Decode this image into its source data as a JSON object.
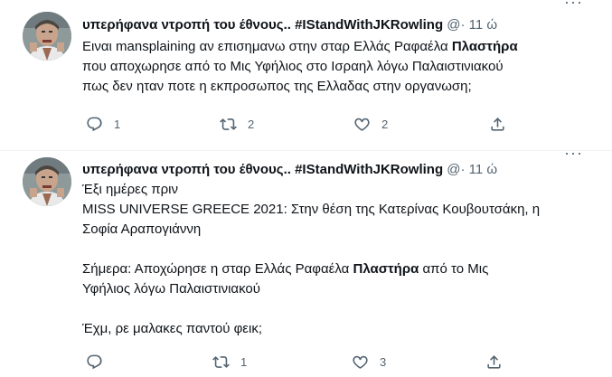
{
  "tweets": [
    {
      "name": "υπερήφανα ντροπή του έθνους.. #IStandWithJKRowling",
      "handle_time": "@· 11 ώ",
      "more": "···",
      "body": [
        {
          "text": "Ειναι mansplaining αν επισημανω στην σταρ Ελλάς Ραφαέλα "
        },
        {
          "text": "Πλαστήρα",
          "bold": true
        },
        {
          "text": "\nπου αποχωρησε από το Μις Υφήλιος στο Ισραηλ λόγω Παλαιστινιακού\nπως δεν ηταν ποτε η εκπροσωπος της Ελλαδας στην οργανωση;"
        }
      ],
      "actions": {
        "reply": "1",
        "retweet": "2",
        "like": "2"
      }
    },
    {
      "name": "υπερήφανα ντροπή του έθνους.. #IStandWithJKRowling",
      "handle_time": "@· 11 ώ",
      "more": "···",
      "body": [
        {
          "text": "Έξι ημέρες πριν\nMISS UNIVERSE GREECE 2021: Στην θέση της Κατερίνας Κουβουτσάκη, η\nΣοφία Αραπογιάννη\n\nΣήμερα: Αποχώρησε η σταρ Ελλάς Ραφαέλα "
        },
        {
          "text": "Πλαστήρα",
          "bold": true
        },
        {
          "text": " από το Μις\nΥφήλιος λόγω Παλαιστινιακού\n\nΈχμ, ρε μαλακες παντού φεικ;"
        }
      ],
      "actions": {
        "reply": "",
        "retweet": "1",
        "like": "3"
      }
    }
  ]
}
